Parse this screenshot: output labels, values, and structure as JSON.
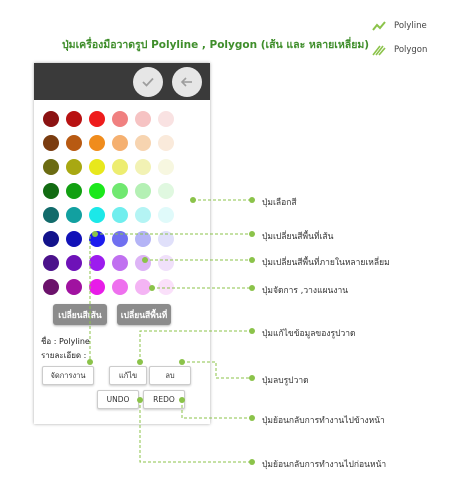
{
  "title": "ปุ่มเครื่องมือวาดรูป Polyline , Polygon (เส้น และ หลายเหลี่ยม)",
  "legend": {
    "polyline": "Polyline",
    "polygon": "Polygon",
    "accent_color": "#8bc34a"
  },
  "panel": {
    "header_color": "#3a3a3a",
    "confirm_icon": "check-icon",
    "back_icon": "arrow-left-icon",
    "palette_rows": [
      [
        "#8b1212",
        "#b81212",
        "#ee1c1c",
        "#f08080",
        "#f6c3c3",
        "#f9e2e2"
      ],
      [
        "#7a3c10",
        "#b85a12",
        "#f08c1c",
        "#f5b070",
        "#f7d4b0",
        "#faeadb"
      ],
      [
        "#6b6b12",
        "#a8a812",
        "#e8e81c",
        "#eded70",
        "#f2f2b4",
        "#f7f7e0"
      ],
      [
        "#126b12",
        "#12a012",
        "#1ce81c",
        "#70e870",
        "#b4f0b4",
        "#e0f8e0"
      ],
      [
        "#126b6b",
        "#12a0a0",
        "#1ce8e8",
        "#70eeee",
        "#b4f4f4",
        "#e0fafa"
      ],
      [
        "#12128b",
        "#1212b8",
        "#1c1cee",
        "#7070f0",
        "#b4b4f6",
        "#e0e0fa"
      ],
      [
        "#4b128b",
        "#6e12b8",
        "#9c1cee",
        "#c070f0",
        "#ddb4f6",
        "#f0e0fa"
      ],
      [
        "#6b126b",
        "#a012a0",
        "#e81ce8",
        "#ee70ee",
        "#f4b4f4",
        "#fae0fa"
      ]
    ],
    "line_color_button": "เปลี่ยนสีเส้น",
    "fill_color_button": "เปลี่ยนสีพื้นที่",
    "name_label": "ชื่อ : Polyline",
    "detail_label": "รายละเอียด :",
    "manage_button": "จัดการงาน",
    "edit_button": "แก้ไข",
    "delete_button": "ลบ",
    "undo_button": "UNDO",
    "redo_button": "REDO"
  },
  "callouts": [
    "ปุ่มเลือกสี",
    "ปุ่มเปลี่ยนสีพื้นที่เส้น",
    "ปุ่มเปลี่ยนสีพื้นที่ภายในหลายเหลี่ยม",
    "ปุ่มจัดการ ,วางแผนงาน",
    "ปุ่มแก้ไขข้อมูลของรูปวาด",
    "ปุ่มลบรูปวาด",
    "ปุ่มย้อนกลับการทำงานไปข้างหน้า",
    "ปุ่มย้อนกลับการทำงานไปก่อนหน้า"
  ]
}
